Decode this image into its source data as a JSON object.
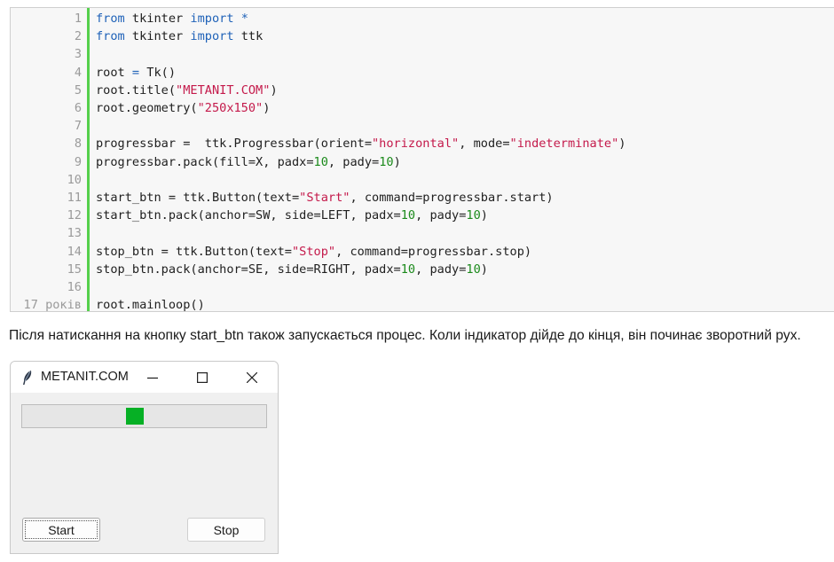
{
  "code": {
    "lines": [
      {
        "n": "1",
        "tokens": [
          [
            "kw",
            "from"
          ],
          [
            "t",
            " tkinter "
          ],
          [
            "kw",
            "import"
          ],
          [
            "t",
            " "
          ],
          [
            "kw",
            "*"
          ]
        ]
      },
      {
        "n": "2",
        "tokens": [
          [
            "kw",
            "from"
          ],
          [
            "t",
            " tkinter "
          ],
          [
            "kw",
            "import"
          ],
          [
            "t",
            " ttk"
          ]
        ]
      },
      {
        "n": "3",
        "tokens": []
      },
      {
        "n": "4",
        "tokens": [
          [
            "t",
            "root "
          ],
          [
            "kw",
            "="
          ],
          [
            "t",
            " Tk()"
          ]
        ]
      },
      {
        "n": "5",
        "tokens": [
          [
            "t",
            "root.title("
          ],
          [
            "str",
            "\"METANIT.COM\""
          ],
          [
            "t",
            ")"
          ]
        ]
      },
      {
        "n": "6",
        "tokens": [
          [
            "t",
            "root.geometry("
          ],
          [
            "str",
            "\"250x150\""
          ],
          [
            "t",
            ")"
          ]
        ]
      },
      {
        "n": "7",
        "tokens": []
      },
      {
        "n": "8",
        "tokens": [
          [
            "t",
            "progressbar =  ttk.Progressbar(orient="
          ],
          [
            "str",
            "\"horizontal\""
          ],
          [
            "t",
            ", mode="
          ],
          [
            "str",
            "\"indeterminate\""
          ],
          [
            "t",
            ")"
          ]
        ]
      },
      {
        "n": "9",
        "tokens": [
          [
            "t",
            "progressbar.pack(fill=X, padx="
          ],
          [
            "num",
            "10"
          ],
          [
            "t",
            ", pady="
          ],
          [
            "num",
            "10"
          ],
          [
            "t",
            ")"
          ]
        ]
      },
      {
        "n": "10",
        "tokens": []
      },
      {
        "n": "11",
        "tokens": [
          [
            "t",
            "start_btn = ttk.Button(text="
          ],
          [
            "str",
            "\"Start\""
          ],
          [
            "t",
            ", command=progressbar.start)"
          ]
        ]
      },
      {
        "n": "12",
        "tokens": [
          [
            "t",
            "start_btn.pack(anchor=SW, side=LEFT, padx="
          ],
          [
            "num",
            "10"
          ],
          [
            "t",
            ", pady="
          ],
          [
            "num",
            "10"
          ],
          [
            "t",
            ")"
          ]
        ]
      },
      {
        "n": "13",
        "tokens": []
      },
      {
        "n": "14",
        "tokens": [
          [
            "t",
            "stop_btn = ttk.Button(text="
          ],
          [
            "str",
            "\"Stop\""
          ],
          [
            "t",
            ", command=progressbar.stop)"
          ]
        ]
      },
      {
        "n": "15",
        "tokens": [
          [
            "t",
            "stop_btn.pack(anchor=SE, side=RIGHT, padx="
          ],
          [
            "num",
            "10"
          ],
          [
            "t",
            ", pady="
          ],
          [
            "num",
            "10"
          ],
          [
            "t",
            ")"
          ]
        ]
      },
      {
        "n": "16",
        "tokens": []
      },
      {
        "n": "17 років",
        "tokens": [
          [
            "t",
            "root.mainloop()"
          ]
        ]
      }
    ]
  },
  "paragraph": "Після натискання на кнопку start_btn також запускається процес. Коли індикатор дійде до кінця, він починає зворотний рух.",
  "window": {
    "title": "METANIT.COM",
    "icon": "feather-icon",
    "progress_indicator_position": 0.46,
    "indicator_color": "#06b025",
    "start_label": "Start",
    "stop_label": "Stop"
  }
}
